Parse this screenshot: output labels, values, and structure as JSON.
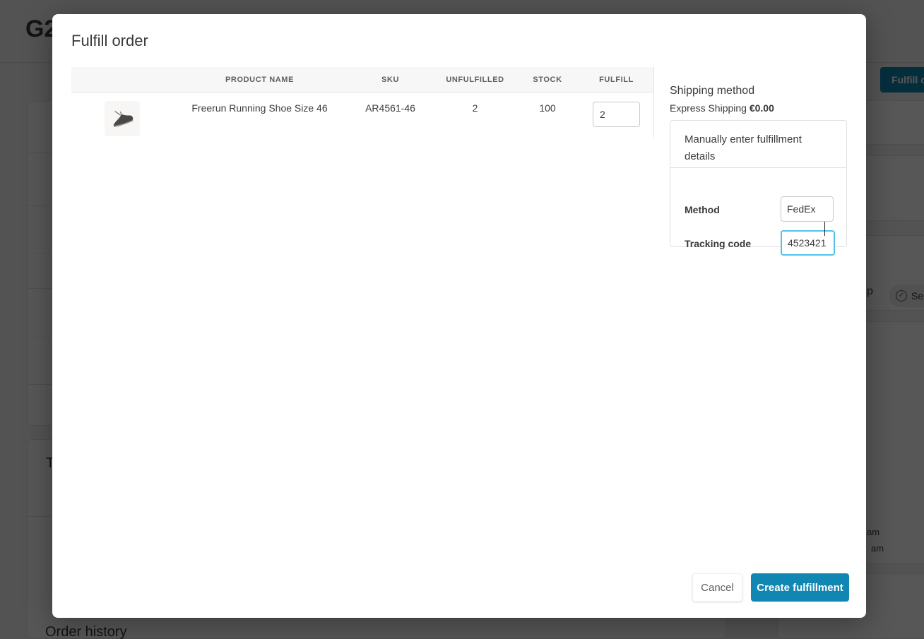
{
  "colors": {
    "primary": "#1086b2",
    "focus_border": "#4fc3e8"
  },
  "background": {
    "page_title": "G2",
    "fulfill_button_label": "Fulfill o",
    "chip": {
      "icon": "check-circle-icon",
      "label": "Se"
    },
    "fragment_p": "p",
    "timestamp_fragment_1": "am",
    "timestamp_fragment_2": "am",
    "card_title_fragment": "T",
    "order_history_title": "Order history"
  },
  "modal": {
    "title": "Fulfill order",
    "table": {
      "headers": [
        "PRODUCT NAME",
        "SKU",
        "UNFULFILLED",
        "STOCK",
        "FULFILL"
      ],
      "rows": [
        {
          "product_image": "running-shoe",
          "product_name": "Freerun Running Shoe Size 46",
          "sku": "AR4561-46",
          "unfulfilled": "2",
          "stock": "100",
          "fulfill_value": "2"
        }
      ]
    },
    "shipping": {
      "heading": "Shipping method",
      "method_name": "Express Shipping",
      "price": "€0.00",
      "panel_title": "Manually enter fulfillment details",
      "method_label": "Method",
      "method_value": "FedEx",
      "tracking_label": "Tracking code",
      "tracking_value": "4523421"
    },
    "footer": {
      "cancel_label": "Cancel",
      "submit_label": "Create fulfillment"
    }
  }
}
